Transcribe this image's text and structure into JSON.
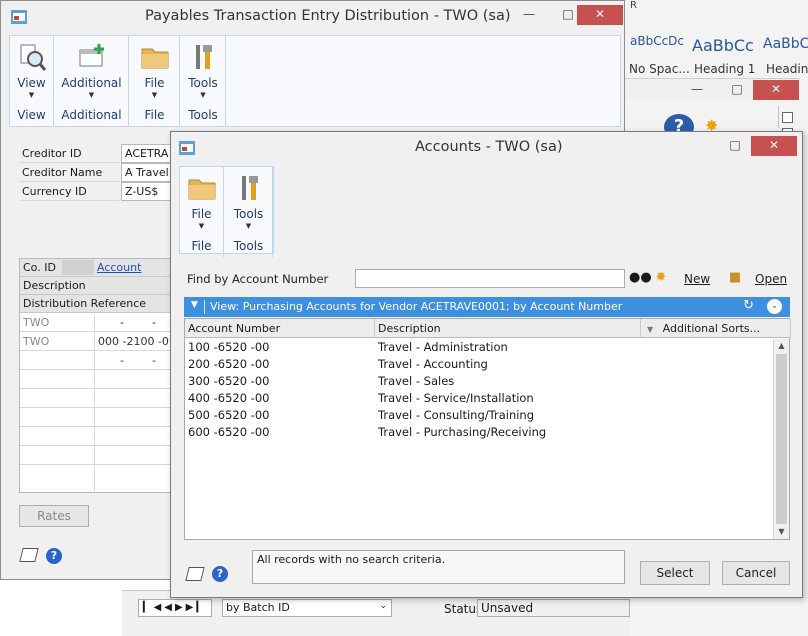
{
  "word": {
    "title_frag": "R",
    "styles": [
      {
        "preview": "aBbCcDc",
        "label": "No Spac..."
      },
      {
        "preview": "AaBbCc",
        "label": "Heading 1"
      },
      {
        "preview": "AaBbC",
        "label": "Heading"
      }
    ]
  },
  "payables": {
    "title": "Payables Transaction Entry Distribution  -  TWO (sa)",
    "ribbon": [
      {
        "label": "View",
        "caption": "View",
        "icon": "magnifier-document-icon"
      },
      {
        "label": "Additional",
        "caption": "Additional",
        "icon": "add-window-icon"
      },
      {
        "label": "File",
        "caption": "File",
        "icon": "folder-icon"
      },
      {
        "label": "Tools",
        "caption": "Tools",
        "icon": "tools-icon"
      }
    ],
    "fields": [
      {
        "label": "Creditor ID",
        "value": "ACETRA"
      },
      {
        "label": "Creditor Name",
        "value": "A Travel"
      },
      {
        "label": "Currency ID",
        "value": "Z-US$"
      }
    ],
    "grid": {
      "co_id": "Co. ID",
      "account": "Account",
      "description": "Description",
      "dist_ref": "Distribution Reference",
      "rows": [
        {
          "co": "TWO",
          "acct": "-        -"
        },
        {
          "co": "TWO",
          "acct": "000 -2100 -0"
        },
        {
          "co": "",
          "acct": "-        -"
        }
      ]
    },
    "rates_button": "Rates",
    "batch_dropdown": "by Batch ID",
    "status_label": "Status",
    "status_value": "Unsaved"
  },
  "accounts": {
    "title": "Accounts  -  TWO (sa)",
    "ribbon": [
      {
        "label": "File",
        "caption": "File",
        "icon": "folder-icon"
      },
      {
        "label": "Tools",
        "caption": "Tools",
        "icon": "tools-icon"
      }
    ],
    "find_label": "Find by Account Number",
    "find_value": "",
    "new_label": "New",
    "open_label": "Open",
    "view_bar": "View: Purchasing Accounts for Vendor ACETRAVE0001; by Account Number",
    "columns": [
      "Account Number",
      "Description",
      "Additional Sorts..."
    ],
    "rows": [
      {
        "account": "100 -6520 -00",
        "description": "Travel - Administration"
      },
      {
        "account": "200 -6520 -00",
        "description": "Travel - Accounting"
      },
      {
        "account": "300 -6520 -00",
        "description": "Travel - Sales"
      },
      {
        "account": "400 -6520 -00",
        "description": "Travel - Service/Installation"
      },
      {
        "account": "500 -6520 -00",
        "description": "Travel - Consulting/Training"
      },
      {
        "account": "600 -6520 -00",
        "description": "Travel - Purchasing/Receiving"
      }
    ],
    "message": "All records with no search criteria.",
    "select_button": "Select",
    "cancel_button": "Cancel"
  }
}
